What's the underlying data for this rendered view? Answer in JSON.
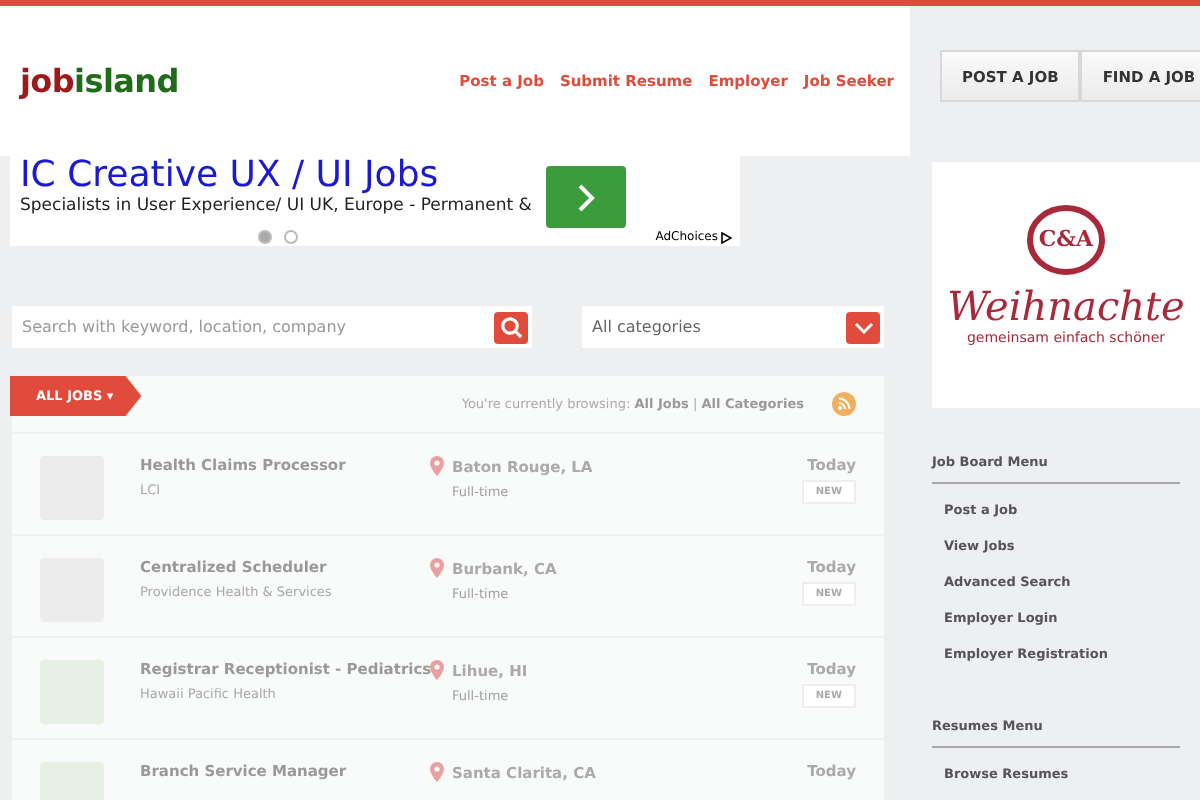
{
  "logo": [
    "job",
    "island"
  ],
  "nav": [
    "Post a Job",
    "Submit Resume",
    "Employer",
    "Job Seeker"
  ],
  "header_buttons": [
    "POST A JOB",
    "FIND A JOB"
  ],
  "ad": {
    "title": "IC Creative UX / UI Jobs",
    "text": "Specialists in User Experience/ UI UK, Europe - Permanent &",
    "adchoices": "AdChoices",
    "dots": [
      {
        "selected": true
      },
      {
        "selected": false
      }
    ]
  },
  "search": {
    "placeholder": "Search with keyword, location, company"
  },
  "category": {
    "value": "All categories"
  },
  "listing": {
    "tab": "ALL JOBS ▾",
    "browsing_label": "You're currently browsing:",
    "browsing_jobs": "All Jobs",
    "separator": "|",
    "browsing_categories": "All Categories",
    "jobs": [
      {
        "title": "Health Claims Processor",
        "company": "LCI",
        "location": "Baton Rouge, LA",
        "type": "Full-time",
        "date": "Today",
        "badge": "NEW",
        "color": "#ececec"
      },
      {
        "title": "Centralized Scheduler",
        "company": "Providence Health & Services",
        "location": "Burbank, CA",
        "type": "Full-time",
        "date": "Today",
        "badge": "NEW",
        "color": "#ececec"
      },
      {
        "title": "Registrar Receptionist - Pediatrics",
        "company": "Hawaii Pacific Health",
        "location": "Lihue, HI",
        "type": "Full-time",
        "date": "Today",
        "badge": "NEW",
        "color": "#e8efe4"
      },
      {
        "title": "Branch Service Manager",
        "location": "Santa Clarita, CA",
        "date": "Today",
        "color": "#e8efe4"
      }
    ]
  },
  "sidebar_ad": {
    "brand": "C&A",
    "headline": "Weihnachte",
    "tagline": "gemeinsam einfach schöner"
  },
  "menus": [
    {
      "title": "Job Board Menu",
      "items": [
        "Post a Job",
        "View Jobs",
        "Advanced Search",
        "Employer Login",
        "Employer Registration"
      ]
    },
    {
      "title": "Resumes Menu",
      "items": [
        "Browse Resumes"
      ]
    }
  ]
}
